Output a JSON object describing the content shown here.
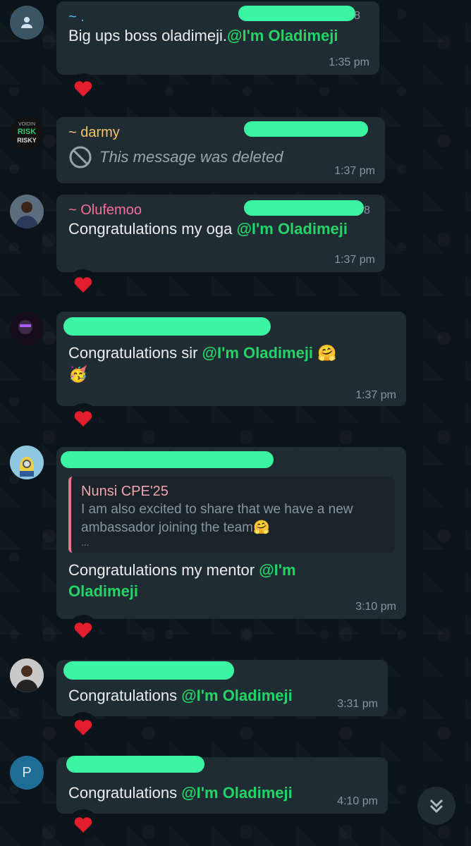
{
  "colors": {
    "background": "#0b141a",
    "bubble": "#202c33",
    "mention": "#25d366",
    "heart": "#e11d2e",
    "redaction": "#3cf5a2"
  },
  "messages": [
    {
      "sender": "~ .",
      "sender_color": "#53bdeb",
      "phone_tail": "8",
      "text": "Big ups boss oladimeji.",
      "mention": "@I'm Oladimeji",
      "time": "1:35 pm",
      "reaction": "heart-icon"
    },
    {
      "sender": "~ darmy",
      "sender_color": "#f5c469",
      "avatar_text": {
        "top": "VOIDIN",
        "middle": "RISK",
        "bottom": "RISKY"
      },
      "deleted_text": "This message was deleted",
      "time": "1:37 pm"
    },
    {
      "sender": "~ Olufemoo",
      "sender_color": "#f2709a",
      "phone_tail": "8",
      "text": "Congratulations my oga ",
      "mention": "@I'm Oladimeji",
      "time": "1:37 pm",
      "reaction": "heart-icon"
    },
    {
      "text": "Congratulations sir ",
      "mention": "@I'm Oladimeji",
      "emoji_1": "🤗",
      "emoji_2": "🥳",
      "time": "1:37 pm",
      "reaction": "heart-icon"
    },
    {
      "reply": {
        "name": "Nunsi CPE'25",
        "text": "I am also excited to share that we have a new ambassador joining the team🤗",
        "ellipsis": "..."
      },
      "text": "Congratulations my mentor ",
      "mention_part1": "@I'm",
      "mention_part2": "Oladimeji",
      "time": "3:10 pm",
      "reaction": "heart-icon"
    },
    {
      "text": "Congratulations ",
      "mention": "@I'm Oladimeji",
      "time": "3:31 pm",
      "reaction": "heart-icon"
    },
    {
      "avatar_letter": "P",
      "text": "Congratulations ",
      "mention": "@I'm Oladimeji",
      "time": "4:10 pm",
      "reaction": "heart-icon"
    }
  ],
  "scroll_down": {
    "icon": "double-chevron-down-icon"
  }
}
